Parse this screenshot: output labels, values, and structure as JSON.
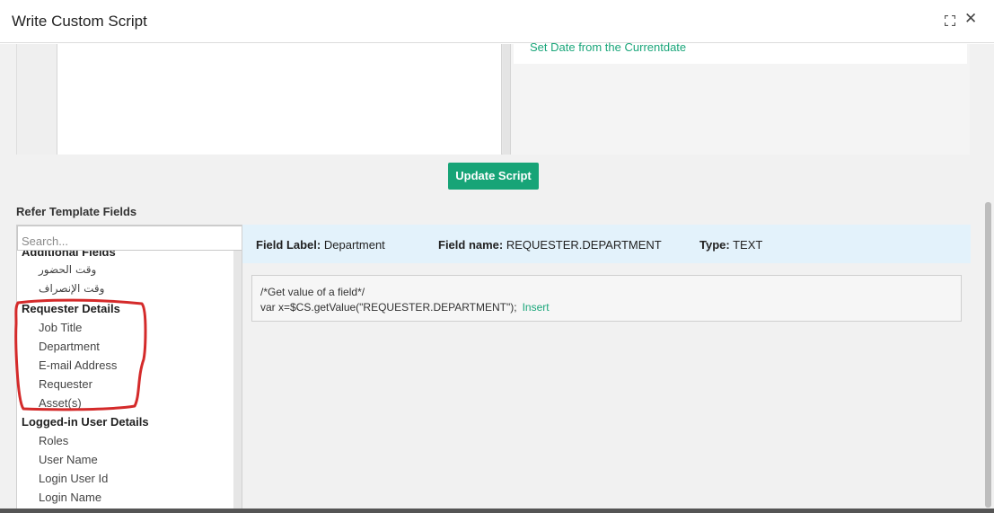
{
  "dialog": {
    "title": "Write Custom Script"
  },
  "snippet": {
    "link": "Set Date from the Currentdate"
  },
  "update_button": "Update Script",
  "refer_label": "Refer Template Fields",
  "search": {
    "placeholder": "Search..."
  },
  "field_groups": [
    {
      "label": "Additional Fields",
      "items": [
        "وقت الحضور",
        "وقت الإنصراف"
      ]
    },
    {
      "label": "Requester Details",
      "items": [
        "Job Title",
        "Department",
        "E-mail Address",
        "Requester",
        "Asset(s)"
      ]
    },
    {
      "label": "Logged-in User Details",
      "items": [
        "Roles",
        "User Name",
        "Login User Id",
        "Login Name"
      ]
    }
  ],
  "field_info": {
    "label_key": "Field Label:",
    "label_value": "Department",
    "name_key": "Field name:",
    "name_value": "REQUESTER.DEPARTMENT",
    "type_key": "Type:",
    "type_value": "TEXT"
  },
  "code_sample": {
    "comment": "/*Get value of a field*/",
    "code": "var x=$CS.getValue(\"REQUESTER.DEPARTMENT\");",
    "insert": "Insert"
  },
  "colors": {
    "accent": "#17a477",
    "annotation": "#d42a2a",
    "info_bg": "#e3f2fb"
  }
}
